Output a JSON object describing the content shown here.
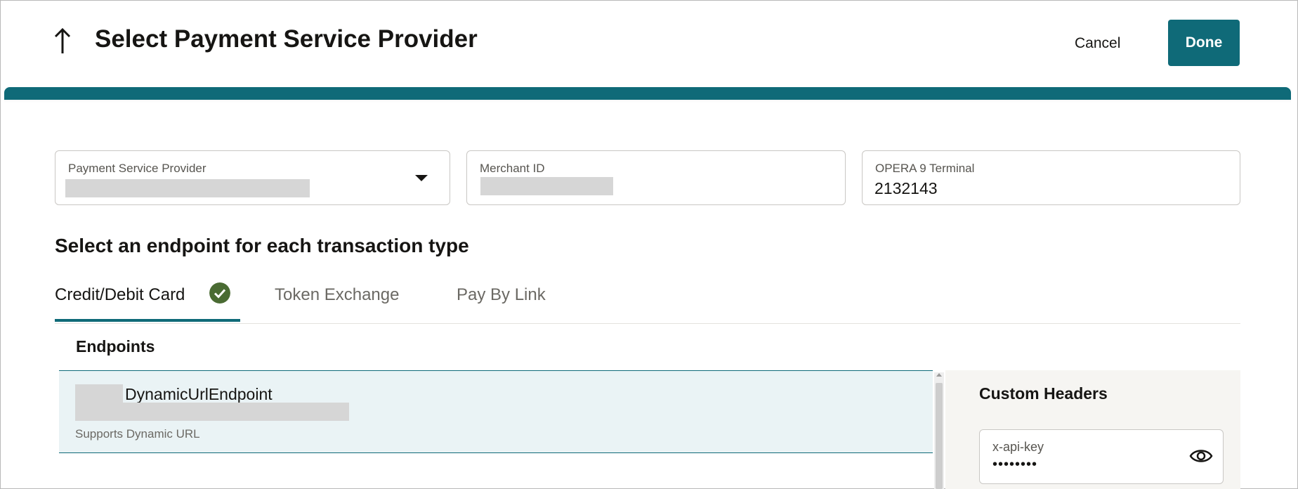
{
  "header": {
    "title": "Select Payment Service Provider",
    "cancel_label": "Cancel",
    "done_label": "Done",
    "back_icon": "arrow-up-icon"
  },
  "accent_color": "#0f6a78",
  "fields": {
    "psp": {
      "label": "Payment Service Provider",
      "value": "",
      "icon": "chevron-down-icon"
    },
    "merchant_id": {
      "label": "Merchant ID",
      "value": ""
    },
    "terminal": {
      "label": "OPERA 9 Terminal",
      "value": "2132143"
    }
  },
  "section_title": "Select an endpoint for each transaction type",
  "tabs": [
    {
      "label": "Credit/Debit Card",
      "active": true,
      "status_icon": "check-circle-icon"
    },
    {
      "label": "Token Exchange",
      "active": false
    },
    {
      "label": "Pay By Link",
      "active": false
    }
  ],
  "endpoints": {
    "heading": "Endpoints",
    "items": [
      {
        "name": "DynamicUrlEndpoint",
        "subtitle": "Supports Dynamic URL",
        "selected": true
      }
    ]
  },
  "custom_headers": {
    "title": "Custom Headers",
    "items": [
      {
        "key": "x-api-key",
        "value": "••••••••",
        "icon": "eye-icon"
      }
    ]
  }
}
